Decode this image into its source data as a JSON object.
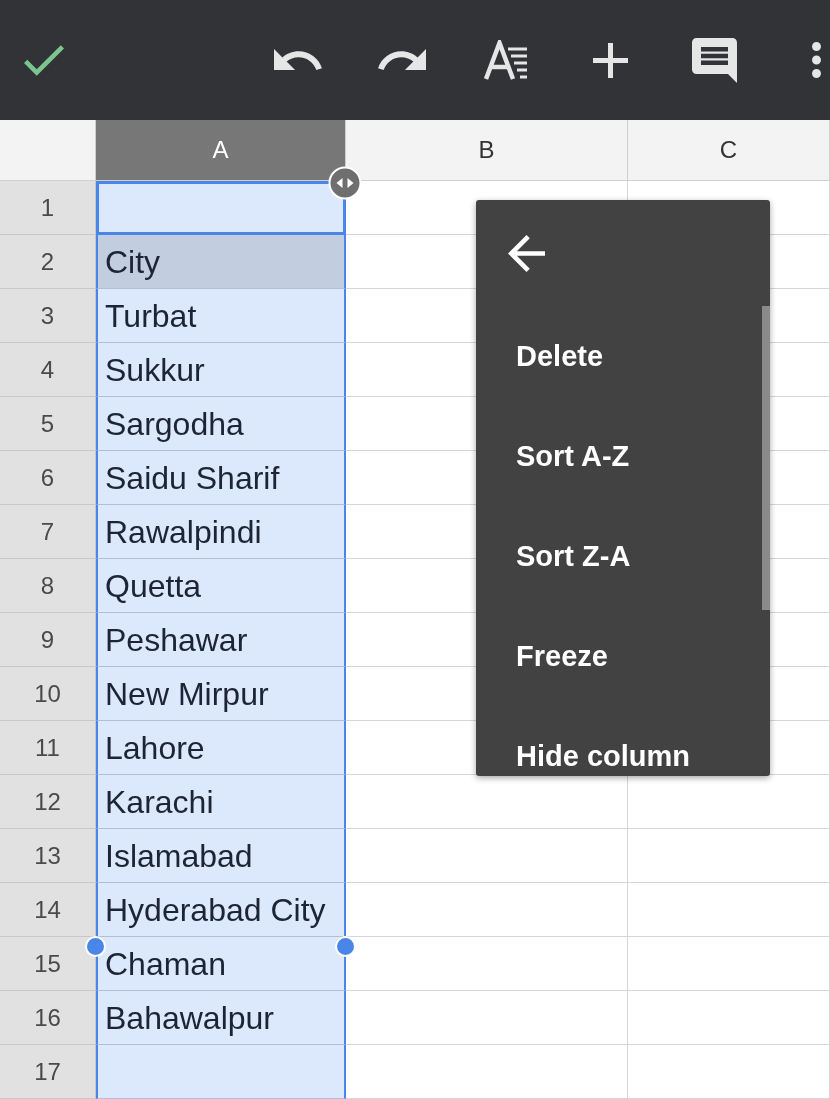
{
  "sheet": {
    "columns": [
      {
        "label": "A",
        "selected": true
      },
      {
        "label": "B",
        "selected": false
      },
      {
        "label": "C",
        "selected": false
      }
    ],
    "rows": [
      {
        "label": "1",
        "active": true,
        "highlighted": false
      },
      {
        "label": "2",
        "cells": [
          "City"
        ],
        "active": false,
        "highlighted": true
      },
      {
        "label": "3",
        "cells": [
          "Turbat"
        ],
        "active": false,
        "highlighted": false
      },
      {
        "label": "4",
        "cells": [
          "Sukkur"
        ],
        "active": false,
        "highlighted": false
      },
      {
        "label": "5",
        "cells": [
          "Sargodha"
        ],
        "active": false,
        "highlighted": false
      },
      {
        "label": "6",
        "cells": [
          "Saidu Sharif"
        ],
        "active": false,
        "highlighted": false
      },
      {
        "label": "7",
        "cells": [
          "Rawalpindi"
        ],
        "active": false,
        "highlighted": false
      },
      {
        "label": "8",
        "cells": [
          "Quetta"
        ],
        "active": false,
        "highlighted": false
      },
      {
        "label": "9",
        "cells": [
          "Peshawar"
        ],
        "active": false,
        "highlighted": false
      },
      {
        "label": "10",
        "cells": [
          "New Mirpur"
        ],
        "active": false,
        "highlighted": false
      },
      {
        "label": "11",
        "cells": [
          "Lahore"
        ],
        "active": false,
        "highlighted": false
      },
      {
        "label": "12",
        "cells": [
          "Karachi"
        ],
        "active": false,
        "highlighted": false
      },
      {
        "label": "13",
        "cells": [
          "Islamabad"
        ],
        "active": false,
        "highlighted": false
      },
      {
        "label": "14",
        "cells": [
          "Hyderabad City"
        ],
        "active": false,
        "highlighted": false
      },
      {
        "label": "15",
        "cells": [
          "Chaman"
        ],
        "active": false,
        "highlighted": false
      },
      {
        "label": "16",
        "cells": [
          "Bahawalpur"
        ],
        "active": false,
        "highlighted": false
      },
      {
        "label": "17",
        "active": false,
        "highlighted": false
      }
    ]
  },
  "context_menu": {
    "items": [
      {
        "label": "Delete"
      },
      {
        "label": "Sort A-Z"
      },
      {
        "label": "Sort Z-A"
      },
      {
        "label": "Freeze"
      },
      {
        "label": "Hide column"
      }
    ]
  }
}
